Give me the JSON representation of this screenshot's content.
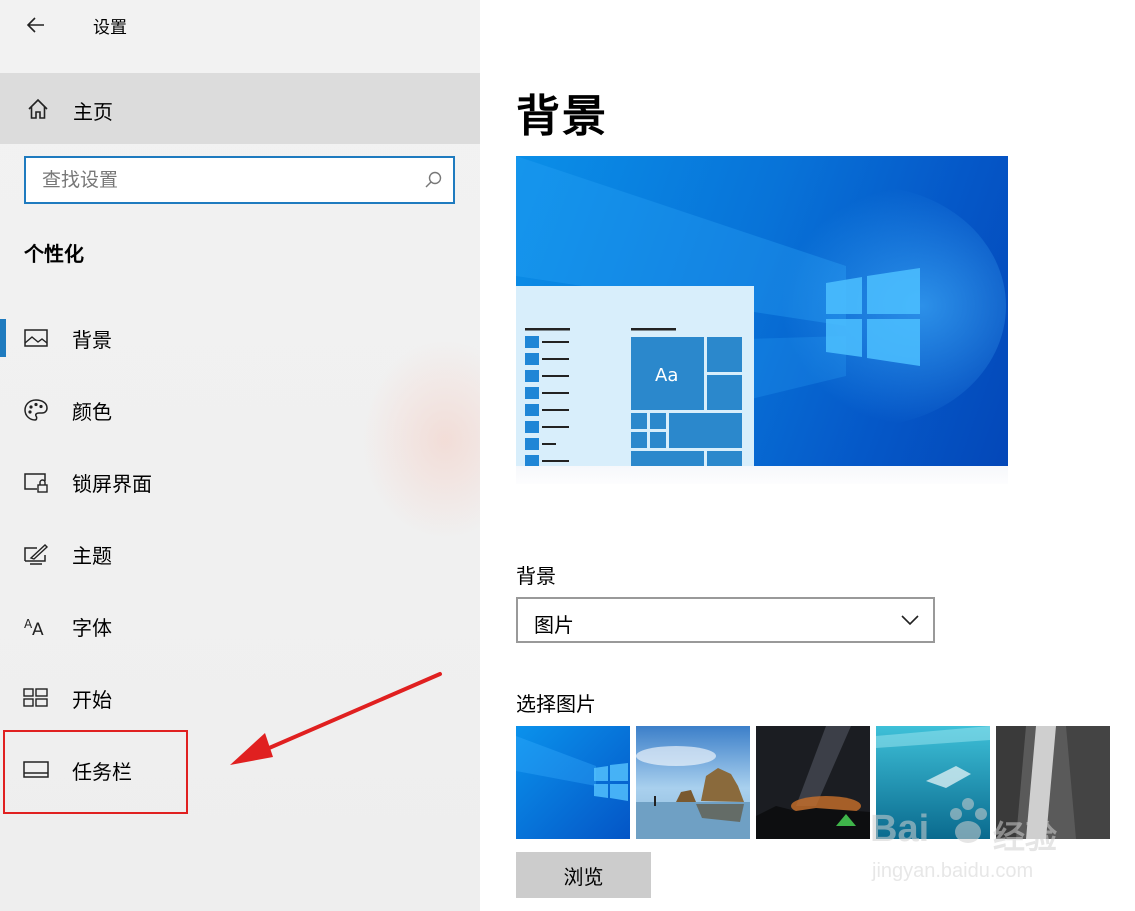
{
  "app": {
    "title": "设置"
  },
  "sidebar": {
    "home_label": "主页",
    "search_placeholder": "查找设置",
    "section_title": "个性化",
    "items": [
      {
        "label": "背景",
        "icon": "picture-icon",
        "selected": true
      },
      {
        "label": "颜色",
        "icon": "palette-icon",
        "selected": false
      },
      {
        "label": "锁屏界面",
        "icon": "lock-screen-icon",
        "selected": false
      },
      {
        "label": "主题",
        "icon": "theme-brush-icon",
        "selected": false
      },
      {
        "label": "字体",
        "icon": "font-icon",
        "selected": false
      },
      {
        "label": "开始",
        "icon": "start-tiles-icon",
        "selected": false
      },
      {
        "label": "任务栏",
        "icon": "taskbar-icon",
        "selected": false
      }
    ],
    "accent_color": "#1f7bbf"
  },
  "main": {
    "page_title": "背景",
    "preview": {
      "tile_text": "Aa"
    },
    "background_label": "背景",
    "background_value": "图片",
    "pick_label": "选择图片",
    "browse_label": "浏览"
  },
  "annotation": {
    "color": "#e02020"
  },
  "watermark": {
    "brand": "Bai",
    "brand_suffix": "经验",
    "url": "jingyan.baidu.com"
  }
}
